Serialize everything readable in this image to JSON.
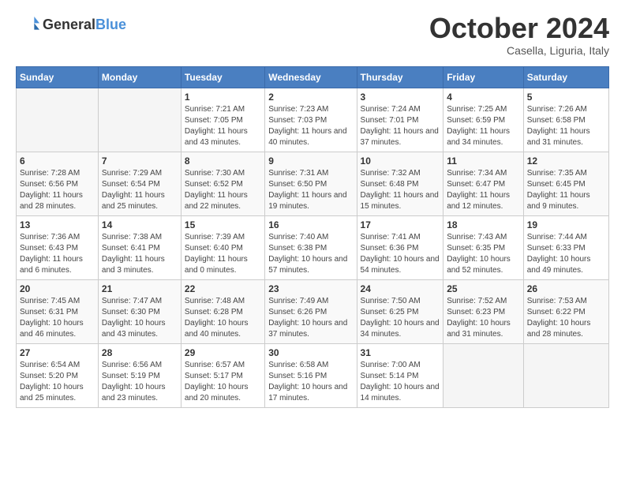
{
  "header": {
    "logo_general": "General",
    "logo_blue": "Blue",
    "month": "October 2024",
    "location": "Casella, Liguria, Italy"
  },
  "weekdays": [
    "Sunday",
    "Monday",
    "Tuesday",
    "Wednesday",
    "Thursday",
    "Friday",
    "Saturday"
  ],
  "weeks": [
    [
      {
        "day": "",
        "sunrise": "",
        "sunset": "",
        "daylight": ""
      },
      {
        "day": "",
        "sunrise": "",
        "sunset": "",
        "daylight": ""
      },
      {
        "day": "1",
        "sunrise": "Sunrise: 7:21 AM",
        "sunset": "Sunset: 7:05 PM",
        "daylight": "Daylight: 11 hours and 43 minutes."
      },
      {
        "day": "2",
        "sunrise": "Sunrise: 7:23 AM",
        "sunset": "Sunset: 7:03 PM",
        "daylight": "Daylight: 11 hours and 40 minutes."
      },
      {
        "day": "3",
        "sunrise": "Sunrise: 7:24 AM",
        "sunset": "Sunset: 7:01 PM",
        "daylight": "Daylight: 11 hours and 37 minutes."
      },
      {
        "day": "4",
        "sunrise": "Sunrise: 7:25 AM",
        "sunset": "Sunset: 6:59 PM",
        "daylight": "Daylight: 11 hours and 34 minutes."
      },
      {
        "day": "5",
        "sunrise": "Sunrise: 7:26 AM",
        "sunset": "Sunset: 6:58 PM",
        "daylight": "Daylight: 11 hours and 31 minutes."
      }
    ],
    [
      {
        "day": "6",
        "sunrise": "Sunrise: 7:28 AM",
        "sunset": "Sunset: 6:56 PM",
        "daylight": "Daylight: 11 hours and 28 minutes."
      },
      {
        "day": "7",
        "sunrise": "Sunrise: 7:29 AM",
        "sunset": "Sunset: 6:54 PM",
        "daylight": "Daylight: 11 hours and 25 minutes."
      },
      {
        "day": "8",
        "sunrise": "Sunrise: 7:30 AM",
        "sunset": "Sunset: 6:52 PM",
        "daylight": "Daylight: 11 hours and 22 minutes."
      },
      {
        "day": "9",
        "sunrise": "Sunrise: 7:31 AM",
        "sunset": "Sunset: 6:50 PM",
        "daylight": "Daylight: 11 hours and 19 minutes."
      },
      {
        "day": "10",
        "sunrise": "Sunrise: 7:32 AM",
        "sunset": "Sunset: 6:48 PM",
        "daylight": "Daylight: 11 hours and 15 minutes."
      },
      {
        "day": "11",
        "sunrise": "Sunrise: 7:34 AM",
        "sunset": "Sunset: 6:47 PM",
        "daylight": "Daylight: 11 hours and 12 minutes."
      },
      {
        "day": "12",
        "sunrise": "Sunrise: 7:35 AM",
        "sunset": "Sunset: 6:45 PM",
        "daylight": "Daylight: 11 hours and 9 minutes."
      }
    ],
    [
      {
        "day": "13",
        "sunrise": "Sunrise: 7:36 AM",
        "sunset": "Sunset: 6:43 PM",
        "daylight": "Daylight: 11 hours and 6 minutes."
      },
      {
        "day": "14",
        "sunrise": "Sunrise: 7:38 AM",
        "sunset": "Sunset: 6:41 PM",
        "daylight": "Daylight: 11 hours and 3 minutes."
      },
      {
        "day": "15",
        "sunrise": "Sunrise: 7:39 AM",
        "sunset": "Sunset: 6:40 PM",
        "daylight": "Daylight: 11 hours and 0 minutes."
      },
      {
        "day": "16",
        "sunrise": "Sunrise: 7:40 AM",
        "sunset": "Sunset: 6:38 PM",
        "daylight": "Daylight: 10 hours and 57 minutes."
      },
      {
        "day": "17",
        "sunrise": "Sunrise: 7:41 AM",
        "sunset": "Sunset: 6:36 PM",
        "daylight": "Daylight: 10 hours and 54 minutes."
      },
      {
        "day": "18",
        "sunrise": "Sunrise: 7:43 AM",
        "sunset": "Sunset: 6:35 PM",
        "daylight": "Daylight: 10 hours and 52 minutes."
      },
      {
        "day": "19",
        "sunrise": "Sunrise: 7:44 AM",
        "sunset": "Sunset: 6:33 PM",
        "daylight": "Daylight: 10 hours and 49 minutes."
      }
    ],
    [
      {
        "day": "20",
        "sunrise": "Sunrise: 7:45 AM",
        "sunset": "Sunset: 6:31 PM",
        "daylight": "Daylight: 10 hours and 46 minutes."
      },
      {
        "day": "21",
        "sunrise": "Sunrise: 7:47 AM",
        "sunset": "Sunset: 6:30 PM",
        "daylight": "Daylight: 10 hours and 43 minutes."
      },
      {
        "day": "22",
        "sunrise": "Sunrise: 7:48 AM",
        "sunset": "Sunset: 6:28 PM",
        "daylight": "Daylight: 10 hours and 40 minutes."
      },
      {
        "day": "23",
        "sunrise": "Sunrise: 7:49 AM",
        "sunset": "Sunset: 6:26 PM",
        "daylight": "Daylight: 10 hours and 37 minutes."
      },
      {
        "day": "24",
        "sunrise": "Sunrise: 7:50 AM",
        "sunset": "Sunset: 6:25 PM",
        "daylight": "Daylight: 10 hours and 34 minutes."
      },
      {
        "day": "25",
        "sunrise": "Sunrise: 7:52 AM",
        "sunset": "Sunset: 6:23 PM",
        "daylight": "Daylight: 10 hours and 31 minutes."
      },
      {
        "day": "26",
        "sunrise": "Sunrise: 7:53 AM",
        "sunset": "Sunset: 6:22 PM",
        "daylight": "Daylight: 10 hours and 28 minutes."
      }
    ],
    [
      {
        "day": "27",
        "sunrise": "Sunrise: 6:54 AM",
        "sunset": "Sunset: 5:20 PM",
        "daylight": "Daylight: 10 hours and 25 minutes."
      },
      {
        "day": "28",
        "sunrise": "Sunrise: 6:56 AM",
        "sunset": "Sunset: 5:19 PM",
        "daylight": "Daylight: 10 hours and 23 minutes."
      },
      {
        "day": "29",
        "sunrise": "Sunrise: 6:57 AM",
        "sunset": "Sunset: 5:17 PM",
        "daylight": "Daylight: 10 hours and 20 minutes."
      },
      {
        "day": "30",
        "sunrise": "Sunrise: 6:58 AM",
        "sunset": "Sunset: 5:16 PM",
        "daylight": "Daylight: 10 hours and 17 minutes."
      },
      {
        "day": "31",
        "sunrise": "Sunrise: 7:00 AM",
        "sunset": "Sunset: 5:14 PM",
        "daylight": "Daylight: 10 hours and 14 minutes."
      },
      {
        "day": "",
        "sunrise": "",
        "sunset": "",
        "daylight": ""
      },
      {
        "day": "",
        "sunrise": "",
        "sunset": "",
        "daylight": ""
      }
    ]
  ]
}
